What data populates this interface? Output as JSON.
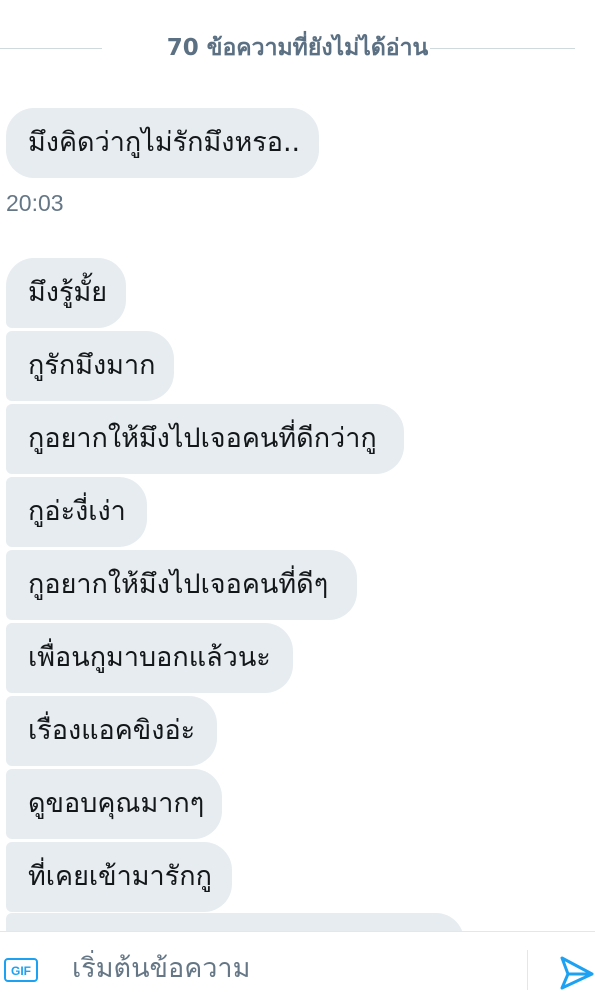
{
  "unread_divider": {
    "label": "70 ข้อความที่ยังไม่ได้อ่าน"
  },
  "messages_before": [
    {
      "text": "มึงคิดว่ากูไม่รักมึงหรอ.."
    }
  ],
  "timestamp": "20:03",
  "messages": [
    {
      "text": "มึงรู้มั้ย"
    },
    {
      "text": "กูรักมึงมาก"
    },
    {
      "text": "กูอยากให้มึงไปเจอคนที่ดีกว่ากู"
    },
    {
      "text": "กูอ่ะงี่เง่า"
    },
    {
      "text": "กูอยากให้มึงไปเจอคนที่ดีๆ"
    },
    {
      "text": "เพื่อนกูมาบอกแล้วนะ"
    },
    {
      "text": "เรื่องแอคขิงอ่ะ"
    },
    {
      "text": "ดูขอบคุณมากๆ"
    },
    {
      "text": "ที่เคยเข้ามารักกู"
    }
  ],
  "composer": {
    "gif_label": "GIF",
    "placeholder": "เริ่มต้นข้อความ"
  },
  "colors": {
    "bubble_bg": "#e6ecf0",
    "accent": "#1da1f2",
    "muted_text": "#657786"
  }
}
